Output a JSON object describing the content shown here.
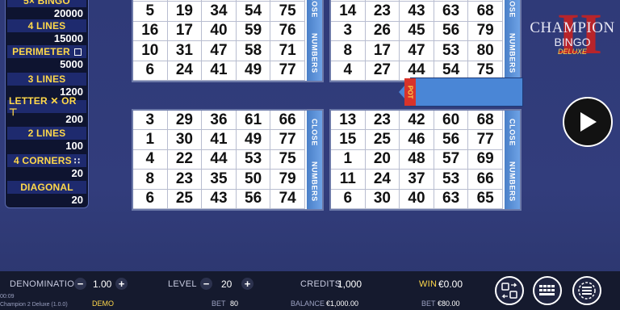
{
  "paytable": [
    {
      "label": "5× BINGO",
      "value": "20000",
      "marker": ""
    },
    {
      "label": "4 LINES",
      "value": "15000",
      "marker": ""
    },
    {
      "label": "PERIMETER",
      "value": "5000",
      "marker": "box"
    },
    {
      "label": "3 LINES",
      "value": "1200",
      "marker": ""
    },
    {
      "label": "LETTER ✕ OR ⊤",
      "value": "200",
      "marker": ""
    },
    {
      "label": "2 LINES",
      "value": "100",
      "marker": ""
    },
    {
      "label": "4 CORNERS",
      "value": "20",
      "marker": "dots"
    },
    {
      "label": "DIAGONAL",
      "value": "20",
      "marker": ""
    }
  ],
  "cards": [
    {
      "rows": [
        [
          "5",
          "19",
          "34",
          "54",
          "75"
        ],
        [
          "16",
          "17",
          "40",
          "59",
          "76"
        ],
        [
          "10",
          "31",
          "47",
          "58",
          "71"
        ],
        [
          "6",
          "24",
          "41",
          "49",
          "77"
        ]
      ]
    },
    {
      "rows": [
        [
          "14",
          "23",
          "43",
          "63",
          "68"
        ],
        [
          "3",
          "26",
          "45",
          "56",
          "79"
        ],
        [
          "8",
          "17",
          "47",
          "53",
          "80"
        ],
        [
          "4",
          "27",
          "44",
          "54",
          "75"
        ]
      ]
    },
    {
      "rows": [
        [
          "3",
          "29",
          "36",
          "61",
          "66"
        ],
        [
          "1",
          "30",
          "41",
          "49",
          "77"
        ],
        [
          "4",
          "22",
          "44",
          "53",
          "75"
        ],
        [
          "8",
          "23",
          "35",
          "50",
          "79"
        ],
        [
          "6",
          "25",
          "43",
          "56",
          "74"
        ]
      ]
    },
    {
      "rows": [
        [
          "13",
          "23",
          "42",
          "60",
          "68"
        ],
        [
          "15",
          "25",
          "46",
          "56",
          "77"
        ],
        [
          "1",
          "20",
          "48",
          "57",
          "69"
        ],
        [
          "11",
          "24",
          "37",
          "53",
          "66"
        ],
        [
          "6",
          "30",
          "40",
          "63",
          "65"
        ]
      ]
    }
  ],
  "card_side": {
    "top": "CLOSE",
    "bottom": "NUMBERS"
  },
  "pot_label": "POT",
  "logo": {
    "numeral": "II",
    "title": "CHAMPION",
    "sub": "BINGO",
    "edition": "DELUXE"
  },
  "bottom": {
    "denomination_label": "DENOMINATION",
    "denomination_value": "1.00",
    "level_label": "LEVEL",
    "level_value": "20",
    "credits_label": "CREDITS",
    "credits_value": "1,000",
    "win_label": "WIN",
    "win_value": "€0.00",
    "mode": "DEMO",
    "bet_label": "BET",
    "bet_value": "80",
    "balance_label": "BALANCE",
    "balance_value": "€1,000.00",
    "bet2_label": "BET",
    "bet2_value": "€80.00",
    "time": "00:09",
    "version": "Champion 2 Deluxe (1.0.0)"
  },
  "colors": {
    "accent": "#ffd84a",
    "card_side": "#5a8fd8",
    "pot_tag": "#d8332a",
    "background": "#2f3a78"
  }
}
